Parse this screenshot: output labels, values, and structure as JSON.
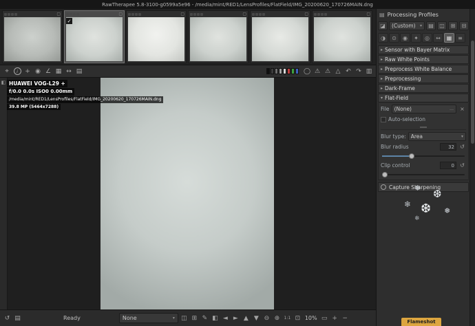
{
  "window": {
    "title": "RawTherapee 5.8-3100-g0599a5e96 - /media/mint/RED1/LensProfiles/FlatField/IMG_20200620_170726MAIN.dng"
  },
  "colors": {
    "accent_blue": "#5d84a8",
    "flameshot_yellow": "#dca53f",
    "swatches": [
      "#101010",
      "#3c3c3c",
      "#6e6e6e",
      "#a2a2a2",
      "#d8d8d8",
      "#c04040",
      "#40a040",
      "#4060c0"
    ]
  },
  "icons": {
    "check": "✓",
    "trash": "▢",
    "menu_arrow": "▾",
    "expander_arrow": "▸",
    "left_strip_toggle": "◧",
    "pan": "⌖",
    "info": "i",
    "wb_picker": "+",
    "color_picker": "◉",
    "straighten": "∠",
    "crop": "▦",
    "resize": "↔",
    "detail_window": "▤",
    "soft_proof": "◯",
    "warning": "⚠",
    "gamut": "△",
    "rotate_left": "↶",
    "rotate_right": "↷",
    "reset": "↺",
    "profiles": "▤",
    "fill_mode": "◪",
    "folder": "▤",
    "save": "◫",
    "copy": "⊞",
    "paste": "⊟",
    "filmstrip_toggle": "▥",
    "file_open": "…",
    "clear": "×",
    "edit": "✎",
    "before_after": "◧",
    "prev": "◄",
    "next": "►",
    "up": "▲",
    "down": "▼",
    "zoom_out": "⊖",
    "zoom_in": "⊕",
    "zoom_100": "1:1",
    "zoom_fit": "⊡",
    "crop_frame": "▭",
    "plus": "+",
    "minus": "−",
    "snow1": "❅",
    "snow2": "❆",
    "snow3": "❄"
  },
  "info_overlay": {
    "camera": "HUAWEI VOG-L29 +",
    "exposure": "f/0.0 0.0s ISO0 0.00mm",
    "path": "/media/mint/RED1/LensProfiles/FlatField/IMG_20200620_170726MAIN.dng",
    "megapixels": "39.8 MP (5464x7288)"
  },
  "right_panel": {
    "title": "Processing Profiles",
    "profile_value": "(Custom)",
    "tool_tabs": [
      "◑",
      "⊙",
      "◉",
      "✦",
      "◎",
      "↔",
      "▦",
      "≡"
    ],
    "sections": [
      {
        "label": "Sensor with Bayer Matrix"
      },
      {
        "label": "Raw White Points"
      },
      {
        "label": "Preprocess White Balance"
      },
      {
        "label": "Preprocessing"
      },
      {
        "label": "Dark-Frame"
      },
      {
        "label": "Flat-Field"
      }
    ],
    "flat_field": {
      "file_label": "File",
      "file_value": "(None)",
      "auto_selection": "Auto-selection",
      "blur_type_label": "Blur type:",
      "blur_type_value": "Area",
      "blur_radius_label": "Blur radius",
      "blur_radius_value": "32",
      "clip_control_label": "Clip control",
      "clip_control_value": "0"
    },
    "capture_sharpening": "Capture Sharpening"
  },
  "statusbar": {
    "status": "Ready",
    "profile_value": "None",
    "zoom_level": "10%"
  },
  "flameshot": {
    "label": "Flameshot"
  }
}
